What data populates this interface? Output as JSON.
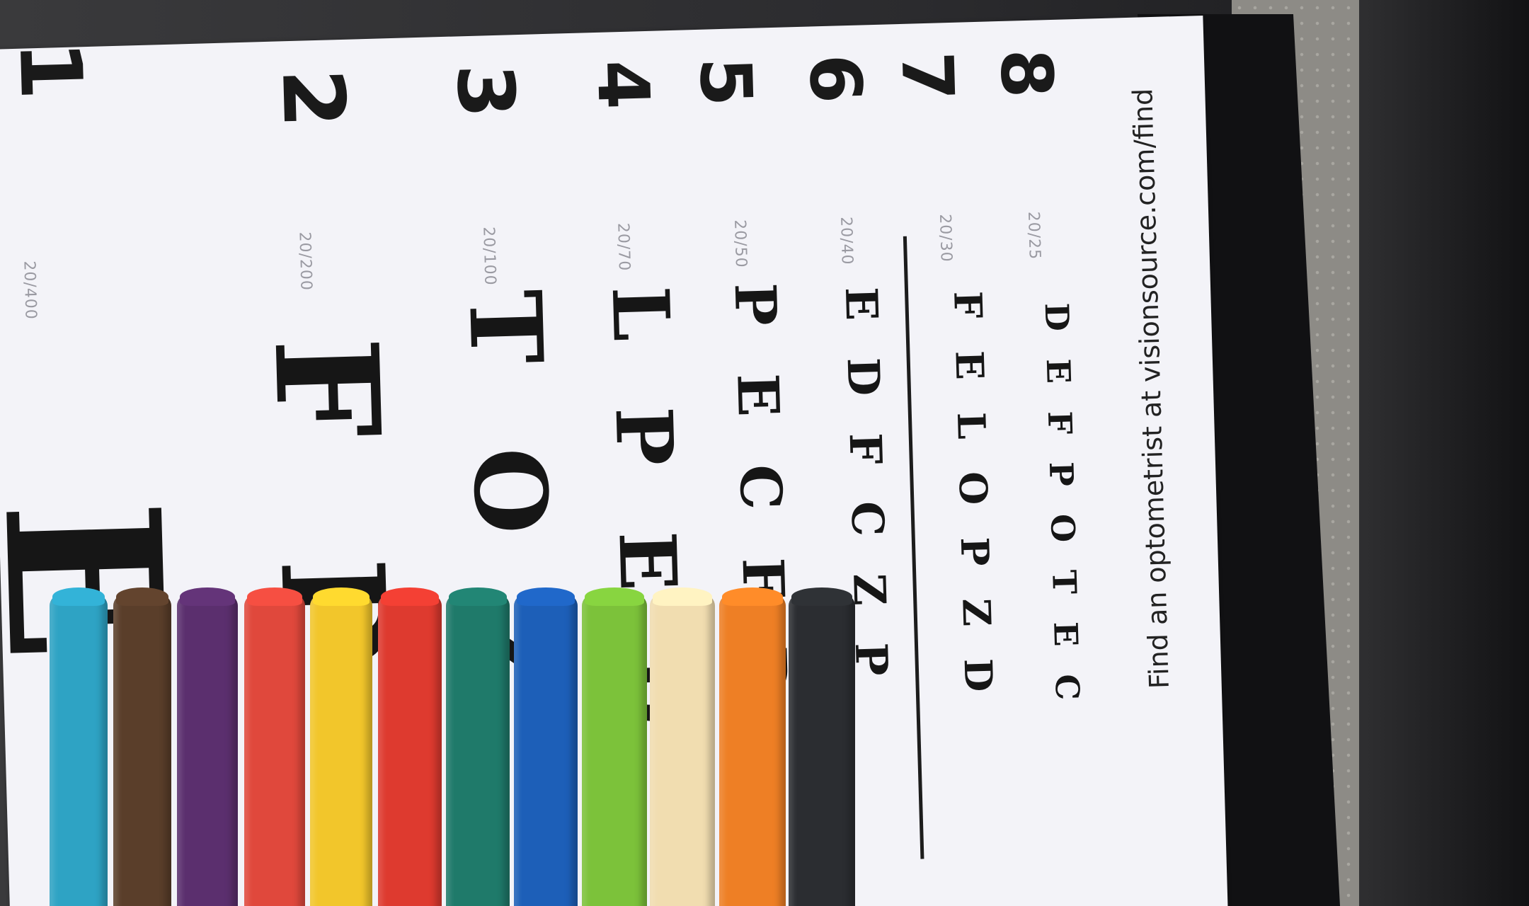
{
  "chart": {
    "rows": [
      {
        "num": "1",
        "acuity": "20/400",
        "letters": "E"
      },
      {
        "num": "2",
        "acuity": "20/200",
        "letters": "F P"
      },
      {
        "num": "3",
        "acuity": "20/100",
        "letters": "T O Z"
      },
      {
        "num": "4",
        "acuity": "20/70",
        "letters": "L P E D"
      },
      {
        "num": "5",
        "acuity": "20/50",
        "letters": "P E C F D"
      },
      {
        "num": "6",
        "acuity": "20/40",
        "letters": "E D F C Z P"
      },
      {
        "num": "7",
        "acuity": "20/30",
        "letters": "F E L O P Z D"
      },
      {
        "num": "8",
        "acuity": "20/25",
        "letters": "D E F P O T E C"
      }
    ],
    "footer": "Find an optometrist at visionsource.com/find"
  },
  "colors": {
    "paper": "#f3f3f8",
    "ink": "#161616",
    "crayons": [
      "#2ea3c4",
      "#5a3e2a",
      "#5b2f6e",
      "#e0483c",
      "#f2c62b",
      "#de3a2f",
      "#1f7a6a",
      "#1d5fb8",
      "#7cc23a",
      "#f1ddb0",
      "#ee7f25",
      "#2b2d31"
    ]
  }
}
